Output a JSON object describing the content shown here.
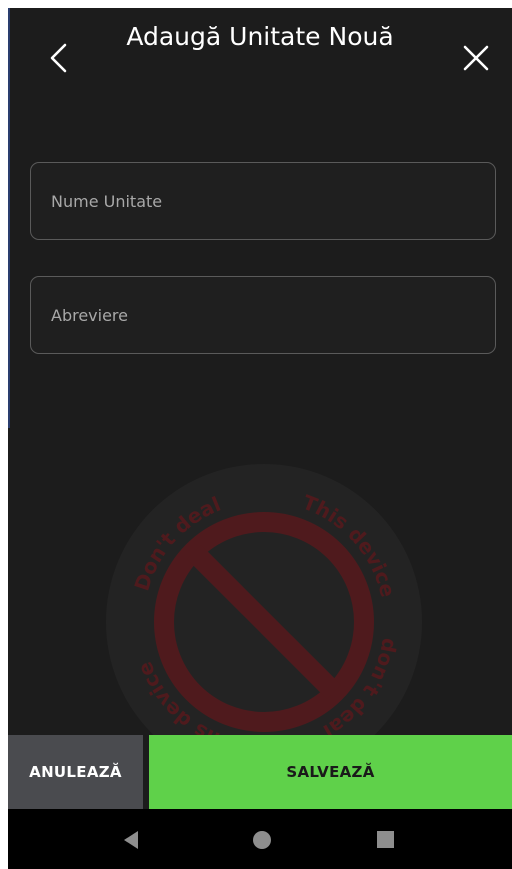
{
  "header": {
    "title": "Adaugă Unitate Nouă",
    "back_icon": "chevron-left-icon",
    "close_icon": "close-icon"
  },
  "form": {
    "unit_name": {
      "placeholder": "Nume Unitate",
      "value": ""
    },
    "abbreviation": {
      "placeholder": "Abreviere",
      "value": ""
    }
  },
  "actions": {
    "cancel_label": "ANULEAZĂ",
    "save_label": "SALVEAZĂ"
  },
  "watermark": {
    "text_top": "This device",
    "text_left": "Don't deal",
    "text_right": "don't deal",
    "text_bottom": "This device"
  },
  "navbar": {
    "back_icon": "nav-back-triangle-icon",
    "home_icon": "nav-home-circle-icon",
    "recents_icon": "nav-recents-square-icon"
  },
  "colors": {
    "background": "#1c1c1c",
    "save_button": "#5fd14a",
    "cancel_button": "#4a4b4f",
    "watermark_red": "#9b1f24"
  }
}
